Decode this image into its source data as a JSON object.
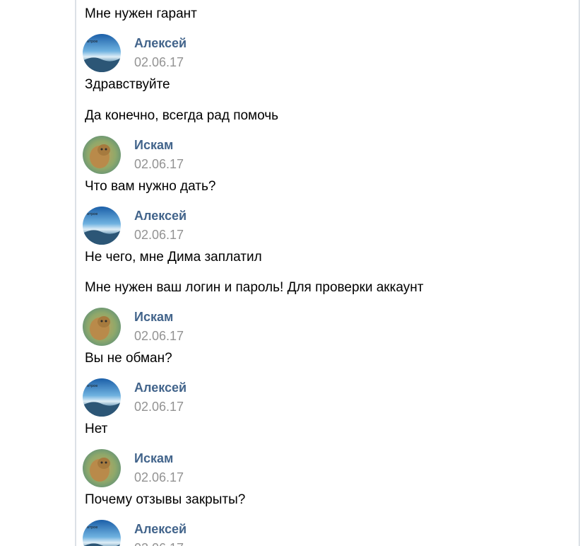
{
  "messages": [
    {
      "text": "Мне нужен гарант"
    },
    {
      "author": "Алексей",
      "date": "02.06.17",
      "avatar": "sky-landscape-avatar",
      "lines": [
        "Здравствуйте",
        "Да конечно, всегда рад помочь"
      ]
    },
    {
      "author": "Искам",
      "date": "02.06.17",
      "avatar": "cat-avatar",
      "lines": [
        "Что вам нужно дать?"
      ]
    },
    {
      "author": "Алексей",
      "date": "02.06.17",
      "avatar": "sky-landscape-avatar",
      "lines": [
        "Не чего, мне Дима заплатил",
        "Мне нужен ваш логин и пароль! Для проверки аккаунт"
      ]
    },
    {
      "author": "Искам",
      "date": "02.06.17",
      "avatar": "cat-avatar",
      "lines": [
        "Вы не обман?"
      ]
    },
    {
      "author": "Алексей",
      "date": "02.06.17",
      "avatar": "sky-landscape-avatar",
      "lines": [
        "Нет"
      ]
    },
    {
      "author": "Искам",
      "date": "02.06.17",
      "avatar": "cat-avatar",
      "lines": [
        "Почему отзывы закрыты?"
      ]
    },
    {
      "author": "Алексей",
      "date": "02.06.17",
      "avatar": "sky-landscape-avatar",
      "lines": []
    }
  ]
}
